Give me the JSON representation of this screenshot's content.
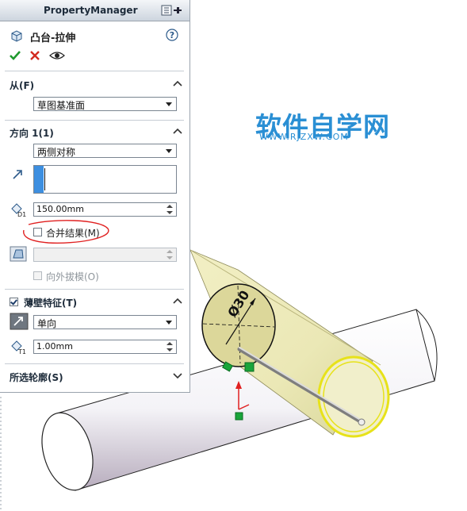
{
  "panel": {
    "title": "PropertyManager",
    "feature_name": "凸台-拉伸",
    "help_icon": "help-icon",
    "actions": [
      "ok-icon",
      "cancel-icon",
      "preview-icon"
    ]
  },
  "from": {
    "header": "从(F)",
    "selected": "草图基准面"
  },
  "direction1": {
    "header": "方向 1(1)",
    "end_condition": "两侧对称",
    "depth": "150.00mm",
    "merge_result_label": "合并结果(M)",
    "merge_result_checked": false,
    "draft_outward_label": "向外拔模(O)",
    "draft_outward_checked": false,
    "depth_icon_label": "D1"
  },
  "thin_feature": {
    "header": "薄壁特征(T)",
    "checked": true,
    "type": "单向",
    "thickness": "1.00mm",
    "thickness_icon_label": "T1"
  },
  "selected_contours": {
    "header": "所选轮廓(S)"
  },
  "watermark": {
    "title": "软件自学网",
    "url": "WWW.RJZXW.COM"
  },
  "annotation": {
    "dimension": "Ø30"
  },
  "colors": {
    "accent_blue": "#2a8fd4",
    "highlight_red": "#e02020",
    "tube_yellow": "#e9e6a6",
    "tube_edge_yellow": "#e7e21a",
    "selection_green": "#19a53a"
  }
}
